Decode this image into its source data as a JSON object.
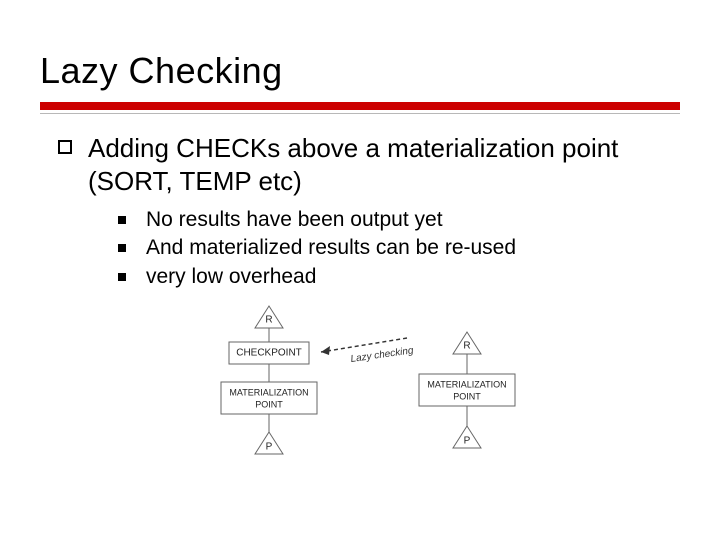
{
  "title": "Lazy Checking",
  "main_point": "Adding CHECKs above a materialization point (SORT, TEMP etc)",
  "sub_points": [
    "No results have been output yet",
    "And materialized results can be re-used",
    "very low overhead"
  ],
  "diagram": {
    "annotation": "Lazy checking",
    "left": {
      "top": "R",
      "box1": "CHECKPOINT",
      "box2_line1": "MATERIALIZATION",
      "box2_line2": "POINT",
      "bottom": "P"
    },
    "right": {
      "top": "R",
      "box_line1": "MATERIALIZATION",
      "box_line2": "POINT",
      "bottom": "P"
    }
  }
}
